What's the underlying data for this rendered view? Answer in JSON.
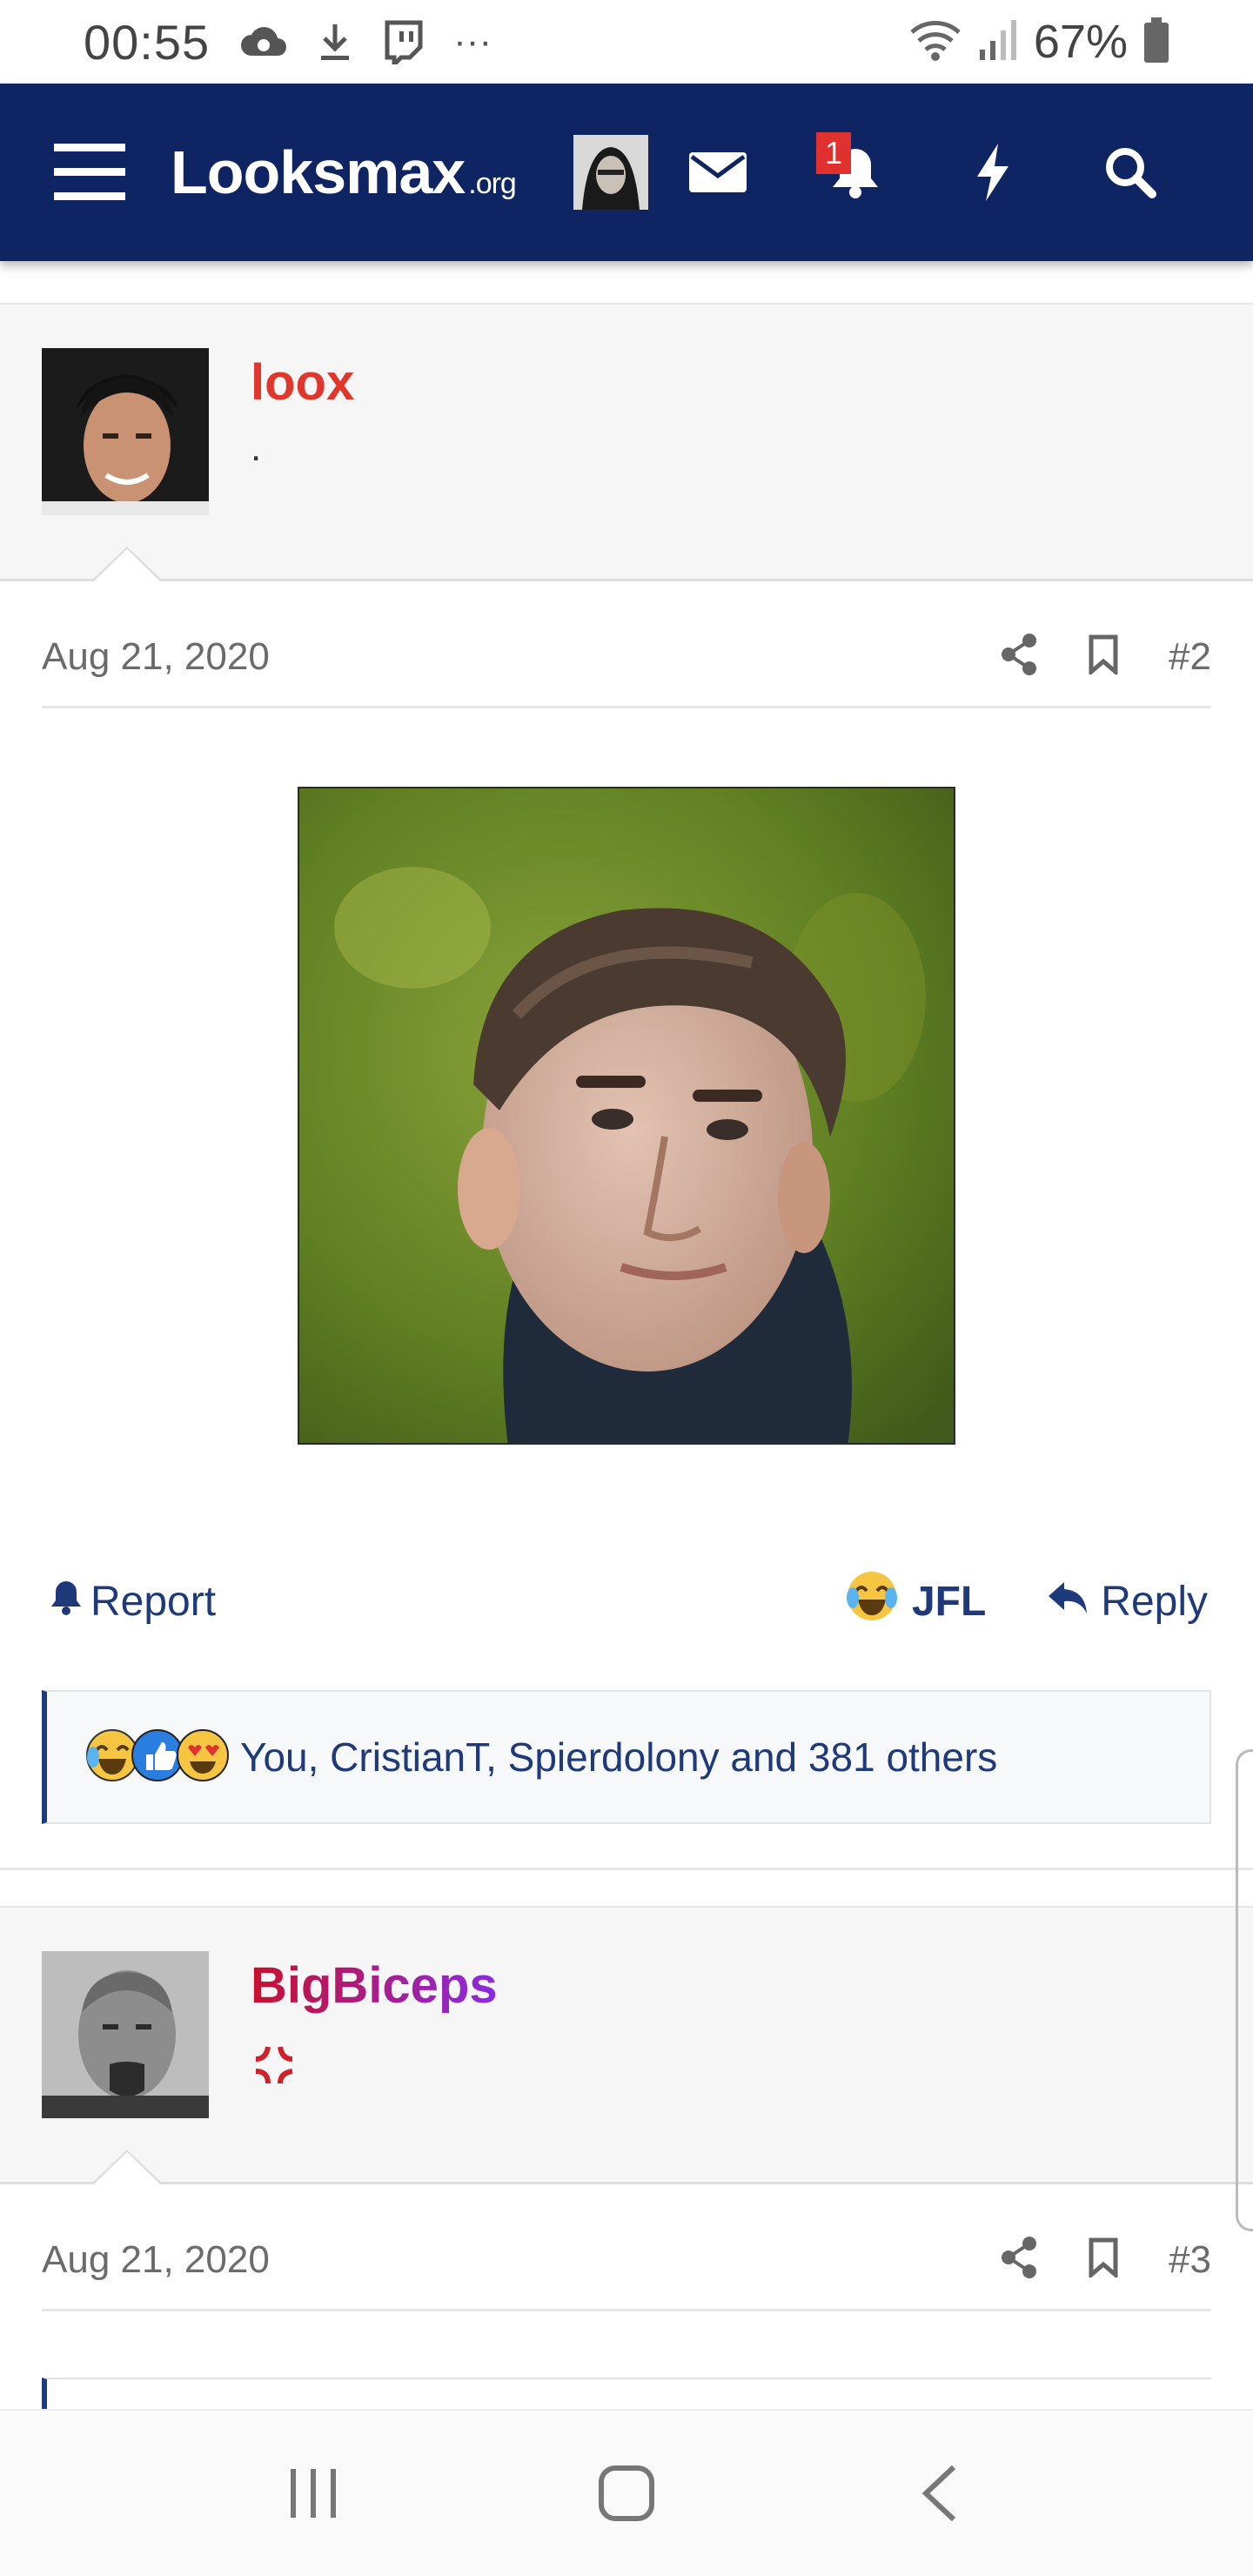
{
  "status_bar": {
    "time": "00:55",
    "battery": "67%",
    "more": "···"
  },
  "navbar": {
    "logo_main": "Looksmax",
    "logo_suffix": ".org",
    "notification_count": "1",
    "bg_color": "#0f2463"
  },
  "posts": [
    {
      "username": "loox",
      "username_color": "#e0362c",
      "user_title": ".",
      "date": "Aug 21, 2020",
      "post_number": "#2"
    },
    {
      "username": "BigBiceps",
      "user_title_icon": "anger-icon",
      "date": "Aug 21, 2020",
      "post_number": "#3"
    }
  ],
  "post_actions": {
    "report_label": "Report",
    "reaction_label": "JFL",
    "reply_label": "Reply"
  },
  "reactions_summary": {
    "text": "You, CristianT, Spierdolony and 381 others"
  },
  "accent_color": "#203a7e"
}
